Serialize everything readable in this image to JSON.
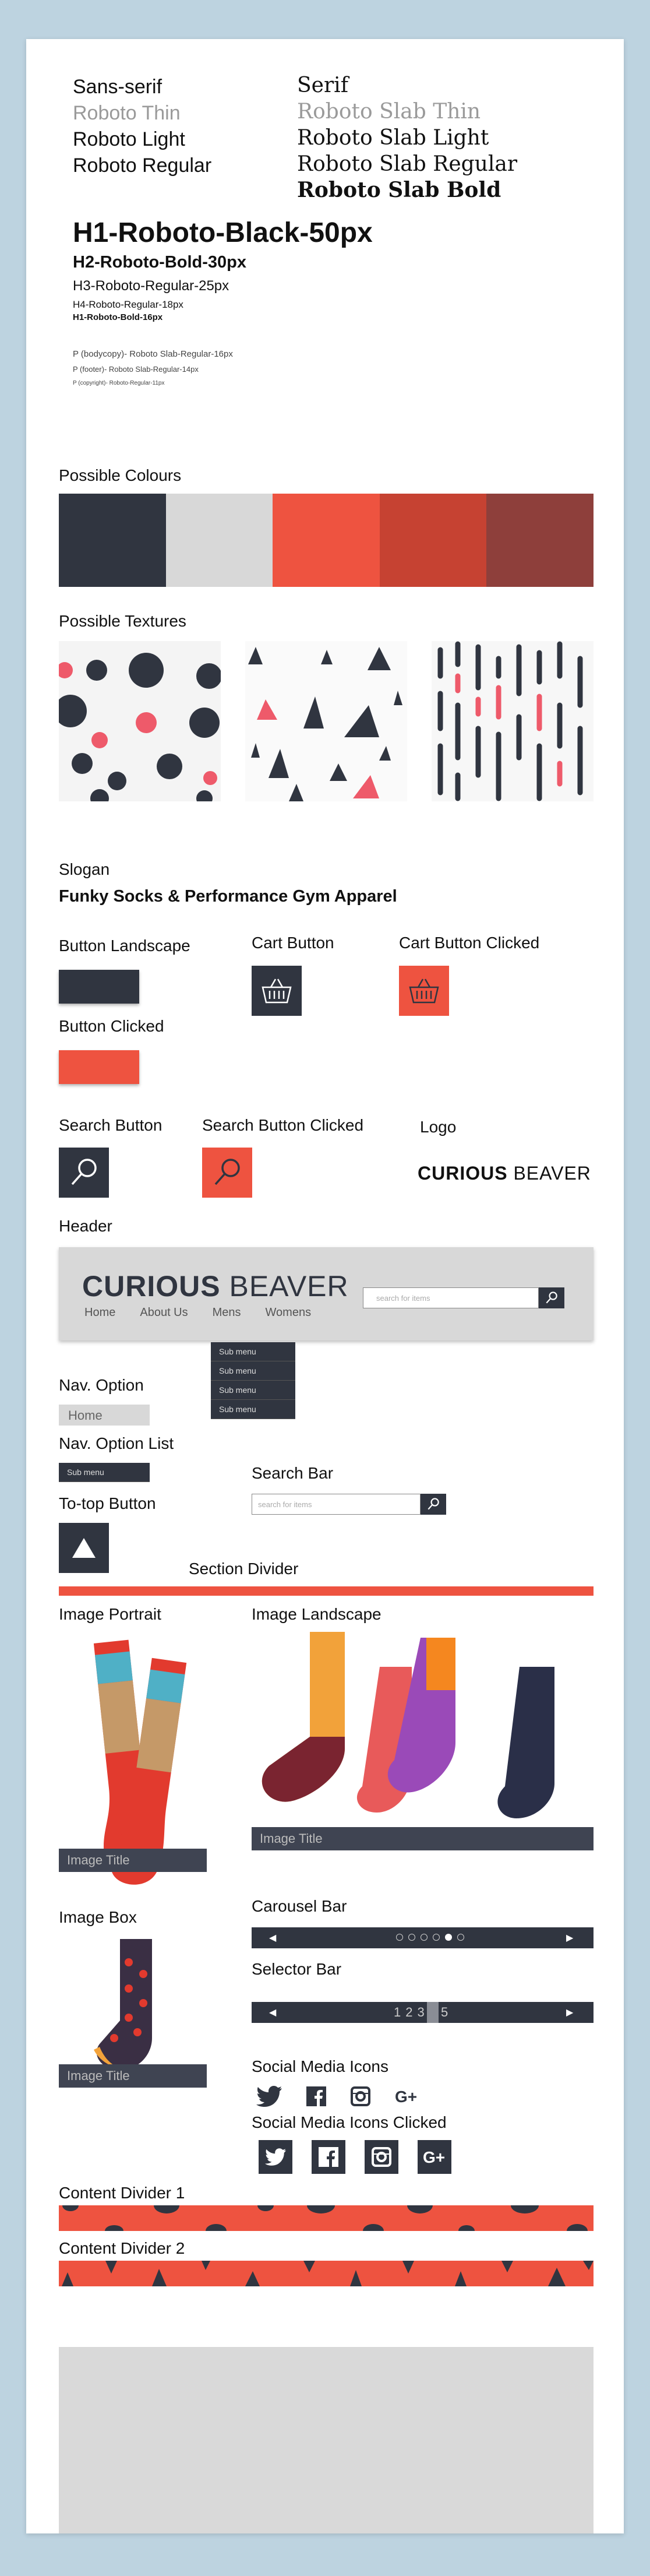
{
  "typography": {
    "sans_heading": "Sans-serif",
    "sans_thin": "Roboto Thin",
    "sans_light": "Roboto Light",
    "sans_regular": "Roboto Regular",
    "serif_heading": "Serif",
    "serif_thin": "Roboto Slab Thin",
    "serif_light": "Roboto Slab Light",
    "serif_regular": "Roboto Slab Regular",
    "serif_bold": "Roboto Slab Bold",
    "h1": "H1-Roboto-Black-50px",
    "h2": "H2-Roboto-Bold-30px",
    "h3": "H3-Roboto-Regular-25px",
    "h4": "H4-Roboto-Regular-18px",
    "h5": "H1-Roboto-Bold-16px",
    "p_body": "P (bodycopy)- Roboto Slab-Regular-16px",
    "p_footer": "P (footer)- Roboto Slab-Regular-14px",
    "p_copyright": "P (copyright)- Roboto-Regular-11px"
  },
  "colours": {
    "label": "Possible Colours",
    "swatches": [
      "#303540",
      "#d8d8d8",
      "#ee5340",
      "#c64232",
      "#8e3f3b"
    ]
  },
  "textures": {
    "label": "Possible Textures"
  },
  "slogan": {
    "label": "Slogan",
    "text": "Funky Socks & Performance Gym Apparel"
  },
  "buttons": {
    "landscape": "Button Landscape",
    "clicked": "Button Clicked",
    "cart": "Cart Button",
    "cart_clicked": "Cart Button Clicked",
    "search": "Search Button",
    "search_clicked": "Search Button Clicked",
    "logo_label": "Logo"
  },
  "logo": {
    "bold": "CURIOUS",
    "light": "BEAVER"
  },
  "header": {
    "label": "Header",
    "nav": [
      "Home",
      "About Us",
      "Mens",
      "Womens"
    ],
    "search_placeholder": "search for items"
  },
  "submenu": [
    "Sub menu",
    "Sub menu",
    "Sub menu",
    "Sub menu"
  ],
  "nav_option": {
    "label": "Nav. Option",
    "item": "Home"
  },
  "nav_option_list": {
    "label": "Nav. Option List",
    "item": "Sub menu"
  },
  "search_bar": {
    "label": "Search Bar",
    "placeholder": "search for items"
  },
  "to_top": {
    "label": "To-top Button"
  },
  "section_divider": {
    "label": "Section Divider"
  },
  "images": {
    "portrait_label": "Image Portrait",
    "landscape_label": "Image Landscape",
    "box_label": "Image Box",
    "title": "Image Title"
  },
  "carousel": {
    "label": "Carousel Bar"
  },
  "selector": {
    "label": "Selector Bar",
    "pages": [
      "1",
      "2",
      "3",
      "4",
      "5"
    ],
    "active": "4"
  },
  "social": {
    "label": "Social Media Icons",
    "clicked_label": "Social Media Icons Clicked"
  },
  "content_divider_1": {
    "label": "Content Divider 1"
  },
  "content_divider_2": {
    "label": "Content Divider 2"
  }
}
